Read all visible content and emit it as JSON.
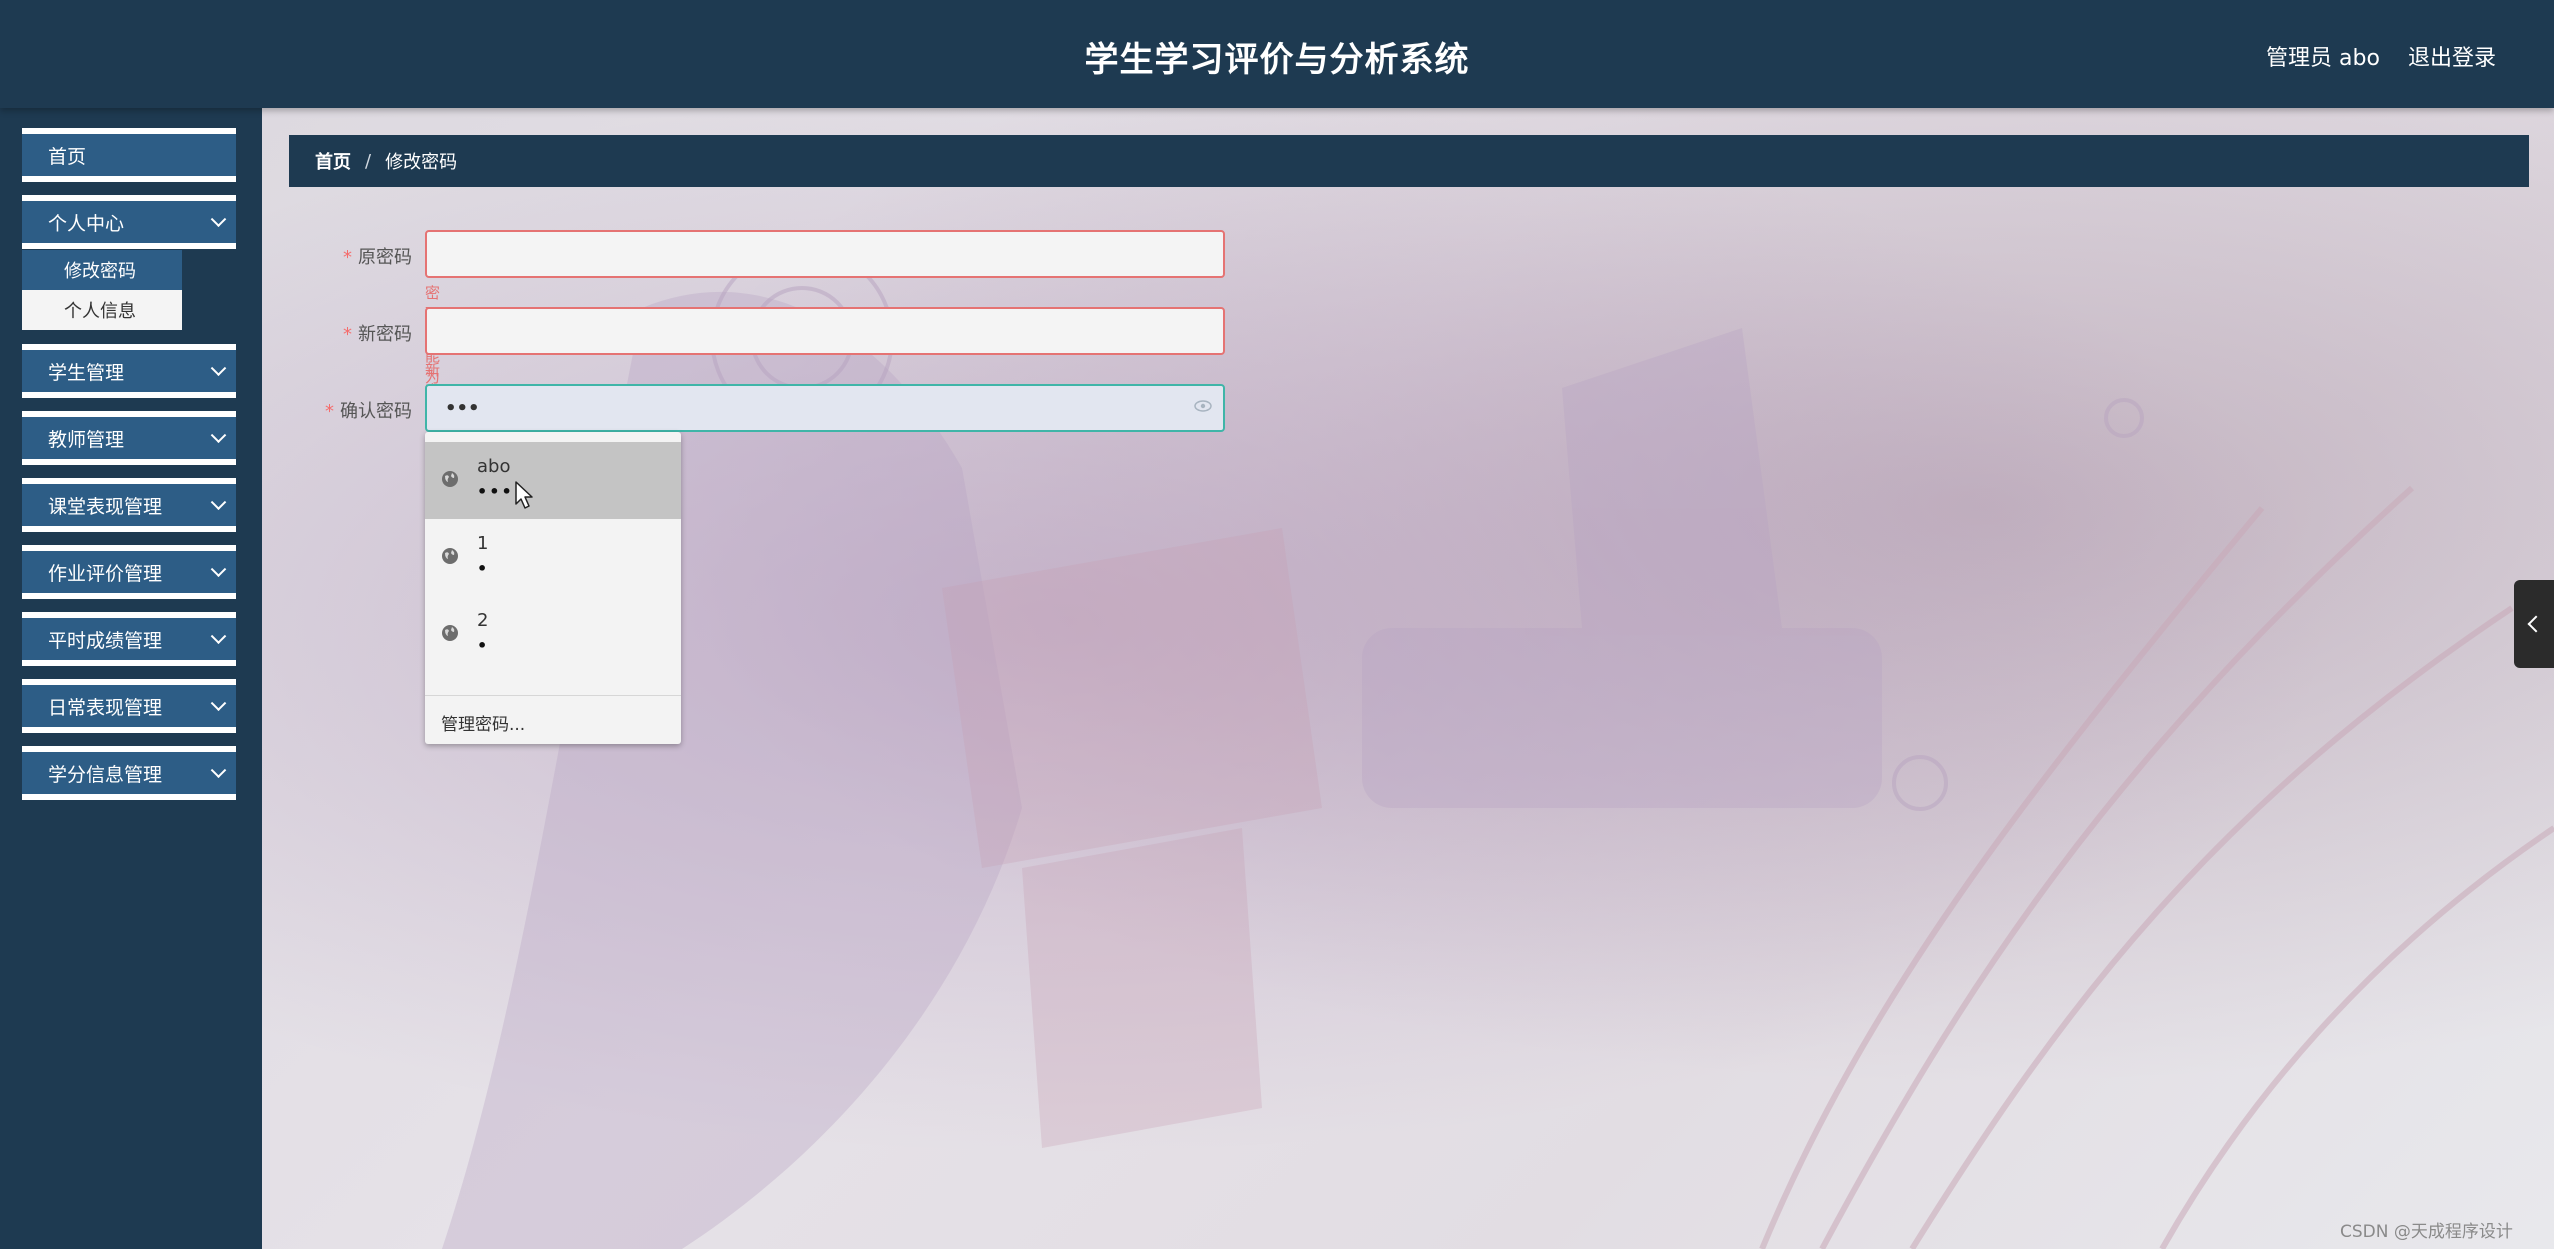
{
  "header": {
    "title": "学生学习评价与分析系统",
    "user_label": "管理员 abo",
    "logout_label": "退出登录"
  },
  "sidebar": {
    "items": [
      {
        "label": "首页",
        "has_chevron": false
      },
      {
        "label": "个人中心",
        "has_chevron": true,
        "expanded": true
      },
      {
        "label": "学生管理",
        "has_chevron": true
      },
      {
        "label": "教师管理",
        "has_chevron": true
      },
      {
        "label": "课堂表现管理",
        "has_chevron": true
      },
      {
        "label": "作业评价管理",
        "has_chevron": true
      },
      {
        "label": "平时成绩管理",
        "has_chevron": true
      },
      {
        "label": "日常表现管理",
        "has_chevron": true
      },
      {
        "label": "学分信息管理",
        "has_chevron": true
      }
    ],
    "submenu": [
      {
        "label": "修改密码",
        "active": true
      },
      {
        "label": "个人信息",
        "active": false
      }
    ]
  },
  "breadcrumb": {
    "home": "首页",
    "separator": "/",
    "current": "修改密码"
  },
  "form": {
    "required_mark": "*",
    "old_password": {
      "label": "原密码",
      "value": "",
      "error": "密码不能为空"
    },
    "new_password": {
      "label": "新密码",
      "value": "",
      "error": "新密码不能为空"
    },
    "confirm_password": {
      "label": "确认密码",
      "value": "•••"
    }
  },
  "autofill": {
    "entries": [
      {
        "username": "abo",
        "password": "•••"
      },
      {
        "username": "1",
        "password": "•"
      },
      {
        "username": "2",
        "password": "•"
      }
    ],
    "manage_label": "管理密码..."
  },
  "watermark": "CSDN @天成程序设计",
  "colors": {
    "header_bg": "#1e3a51",
    "menu_item_bg": "#2d5d86",
    "error": "#e57373",
    "focus_border": "#3fb5a8"
  }
}
